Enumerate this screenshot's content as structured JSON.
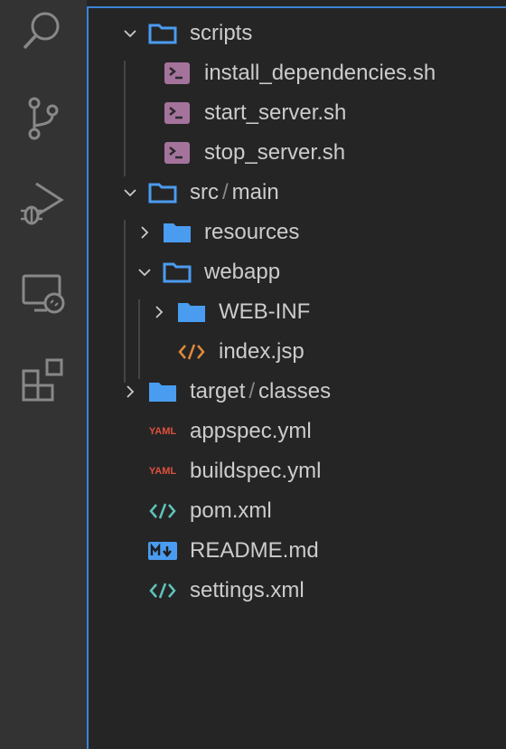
{
  "activity_bar": [
    {
      "name": "search"
    },
    {
      "name": "source-control"
    },
    {
      "name": "run-and-debug"
    },
    {
      "name": "remote-explorer"
    },
    {
      "name": "extensions"
    }
  ],
  "tree": [
    {
      "label": "scripts",
      "type": "folder",
      "expanded": true,
      "depth": 0
    },
    {
      "label": "install_dependencies.sh",
      "type": "shell",
      "depth": 1
    },
    {
      "label": "start_server.sh",
      "type": "shell",
      "depth": 1
    },
    {
      "label": "stop_server.sh",
      "type": "shell",
      "depth": 1
    },
    {
      "label": "src",
      "label2": "main",
      "sep": "/",
      "type": "folder",
      "expanded": true,
      "depth": 0
    },
    {
      "label": "resources",
      "type": "folder",
      "expanded": false,
      "depth": 1
    },
    {
      "label": "webapp",
      "type": "folder",
      "expanded": true,
      "depth": 1
    },
    {
      "label": "WEB-INF",
      "type": "folder",
      "expanded": false,
      "depth": 2
    },
    {
      "label": "index.jsp",
      "type": "jsp",
      "depth": 2
    },
    {
      "label": "target",
      "label2": "classes",
      "sep": "/",
      "type": "folder",
      "expanded": false,
      "depth": 0
    },
    {
      "label": "appspec.yml",
      "type": "yaml",
      "icon_text": "YAML",
      "depth": 0
    },
    {
      "label": "buildspec.yml",
      "type": "yaml",
      "icon_text": "YAML",
      "depth": 0
    },
    {
      "label": "pom.xml",
      "type": "xml",
      "depth": 0
    },
    {
      "label": "README.md",
      "type": "md",
      "depth": 0
    },
    {
      "label": "settings.xml",
      "type": "xml",
      "depth": 0
    }
  ],
  "colors": {
    "accent": "#3b83d6",
    "folder": "#4a9cf0",
    "shell": "#a4739c",
    "yaml": "#e0503c",
    "xml": "#5fc4b8",
    "jsp": "#e08a3c"
  }
}
